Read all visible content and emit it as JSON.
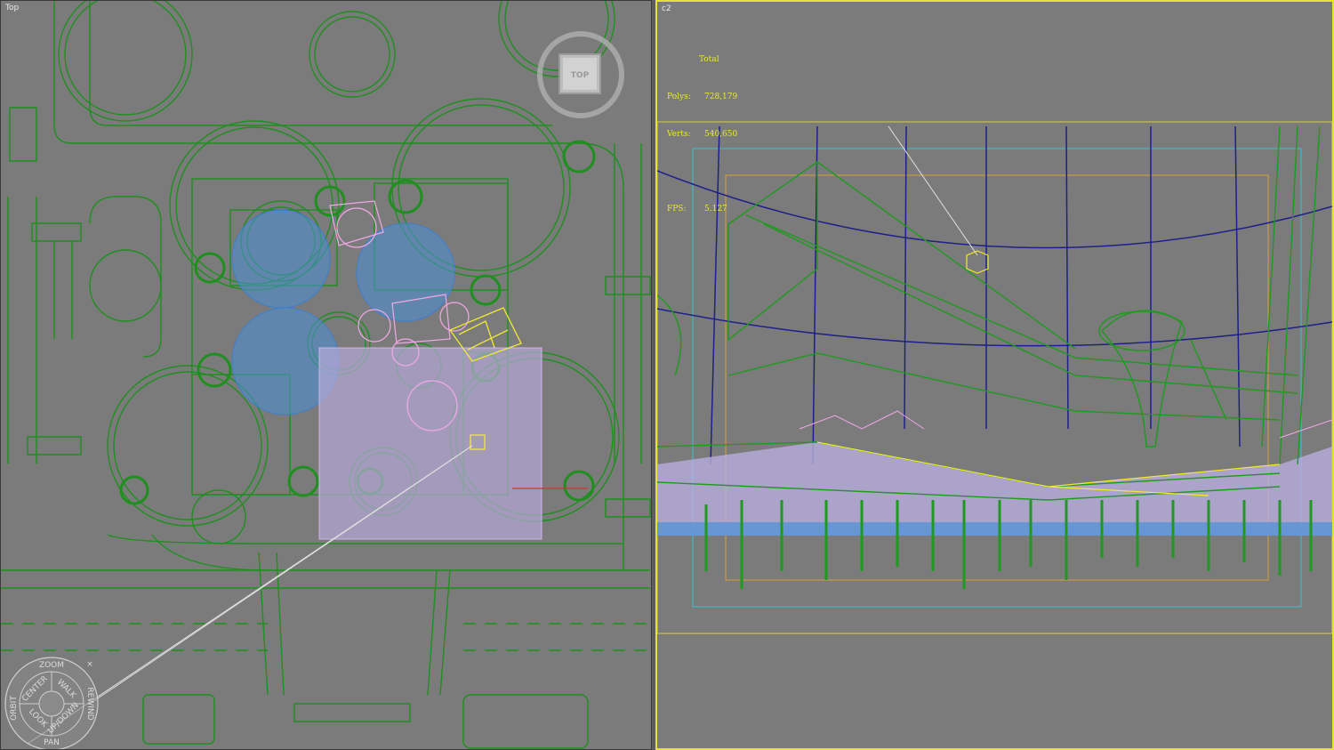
{
  "viewports": {
    "left": {
      "label": "Top"
    },
    "right": {
      "label": "c2"
    }
  },
  "stats": {
    "total_label": "Total",
    "polys_label": "Polys:",
    "polys_value": "728,179",
    "verts_label": "Verts:",
    "verts_value": "540,650",
    "fps_label": "FPS:",
    "fps_value": "5.127"
  },
  "viewcube": {
    "face_label": "TOP",
    "icon": "viewcube-icon"
  },
  "steering_wheel": {
    "icon": "steering-wheel-icon",
    "zoom": "ZOOM",
    "orbit": "ORBIT",
    "center": "CENTER",
    "walk": "WALK",
    "rewind": "REWIND",
    "look": "LOOK",
    "updown": "UP/DOWN",
    "pan": "PAN"
  },
  "colors": {
    "viewport_bg": "#7b7b7b",
    "wire_green": "#1f8f1f",
    "active_border": "#e6e233",
    "stats_text": "#e9e93a"
  }
}
